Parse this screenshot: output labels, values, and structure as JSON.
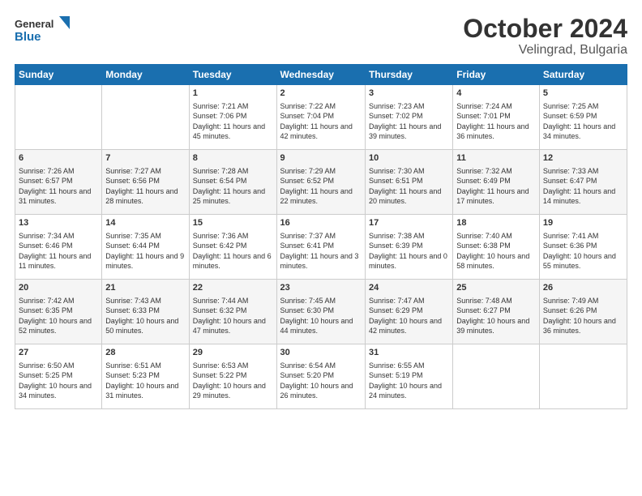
{
  "header": {
    "logo_line1": "General",
    "logo_line2": "Blue",
    "month": "October 2024",
    "location": "Velingrad, Bulgaria"
  },
  "days_of_week": [
    "Sunday",
    "Monday",
    "Tuesday",
    "Wednesday",
    "Thursday",
    "Friday",
    "Saturday"
  ],
  "weeks": [
    [
      {
        "num": "",
        "info": ""
      },
      {
        "num": "",
        "info": ""
      },
      {
        "num": "1",
        "info": "Sunrise: 7:21 AM\nSunset: 7:06 PM\nDaylight: 11 hours and 45 minutes."
      },
      {
        "num": "2",
        "info": "Sunrise: 7:22 AM\nSunset: 7:04 PM\nDaylight: 11 hours and 42 minutes."
      },
      {
        "num": "3",
        "info": "Sunrise: 7:23 AM\nSunset: 7:02 PM\nDaylight: 11 hours and 39 minutes."
      },
      {
        "num": "4",
        "info": "Sunrise: 7:24 AM\nSunset: 7:01 PM\nDaylight: 11 hours and 36 minutes."
      },
      {
        "num": "5",
        "info": "Sunrise: 7:25 AM\nSunset: 6:59 PM\nDaylight: 11 hours and 34 minutes."
      }
    ],
    [
      {
        "num": "6",
        "info": "Sunrise: 7:26 AM\nSunset: 6:57 PM\nDaylight: 11 hours and 31 minutes."
      },
      {
        "num": "7",
        "info": "Sunrise: 7:27 AM\nSunset: 6:56 PM\nDaylight: 11 hours and 28 minutes."
      },
      {
        "num": "8",
        "info": "Sunrise: 7:28 AM\nSunset: 6:54 PM\nDaylight: 11 hours and 25 minutes."
      },
      {
        "num": "9",
        "info": "Sunrise: 7:29 AM\nSunset: 6:52 PM\nDaylight: 11 hours and 22 minutes."
      },
      {
        "num": "10",
        "info": "Sunrise: 7:30 AM\nSunset: 6:51 PM\nDaylight: 11 hours and 20 minutes."
      },
      {
        "num": "11",
        "info": "Sunrise: 7:32 AM\nSunset: 6:49 PM\nDaylight: 11 hours and 17 minutes."
      },
      {
        "num": "12",
        "info": "Sunrise: 7:33 AM\nSunset: 6:47 PM\nDaylight: 11 hours and 14 minutes."
      }
    ],
    [
      {
        "num": "13",
        "info": "Sunrise: 7:34 AM\nSunset: 6:46 PM\nDaylight: 11 hours and 11 minutes."
      },
      {
        "num": "14",
        "info": "Sunrise: 7:35 AM\nSunset: 6:44 PM\nDaylight: 11 hours and 9 minutes."
      },
      {
        "num": "15",
        "info": "Sunrise: 7:36 AM\nSunset: 6:42 PM\nDaylight: 11 hours and 6 minutes."
      },
      {
        "num": "16",
        "info": "Sunrise: 7:37 AM\nSunset: 6:41 PM\nDaylight: 11 hours and 3 minutes."
      },
      {
        "num": "17",
        "info": "Sunrise: 7:38 AM\nSunset: 6:39 PM\nDaylight: 11 hours and 0 minutes."
      },
      {
        "num": "18",
        "info": "Sunrise: 7:40 AM\nSunset: 6:38 PM\nDaylight: 10 hours and 58 minutes."
      },
      {
        "num": "19",
        "info": "Sunrise: 7:41 AM\nSunset: 6:36 PM\nDaylight: 10 hours and 55 minutes."
      }
    ],
    [
      {
        "num": "20",
        "info": "Sunrise: 7:42 AM\nSunset: 6:35 PM\nDaylight: 10 hours and 52 minutes."
      },
      {
        "num": "21",
        "info": "Sunrise: 7:43 AM\nSunset: 6:33 PM\nDaylight: 10 hours and 50 minutes."
      },
      {
        "num": "22",
        "info": "Sunrise: 7:44 AM\nSunset: 6:32 PM\nDaylight: 10 hours and 47 minutes."
      },
      {
        "num": "23",
        "info": "Sunrise: 7:45 AM\nSunset: 6:30 PM\nDaylight: 10 hours and 44 minutes."
      },
      {
        "num": "24",
        "info": "Sunrise: 7:47 AM\nSunset: 6:29 PM\nDaylight: 10 hours and 42 minutes."
      },
      {
        "num": "25",
        "info": "Sunrise: 7:48 AM\nSunset: 6:27 PM\nDaylight: 10 hours and 39 minutes."
      },
      {
        "num": "26",
        "info": "Sunrise: 7:49 AM\nSunset: 6:26 PM\nDaylight: 10 hours and 36 minutes."
      }
    ],
    [
      {
        "num": "27",
        "info": "Sunrise: 6:50 AM\nSunset: 5:25 PM\nDaylight: 10 hours and 34 minutes."
      },
      {
        "num": "28",
        "info": "Sunrise: 6:51 AM\nSunset: 5:23 PM\nDaylight: 10 hours and 31 minutes."
      },
      {
        "num": "29",
        "info": "Sunrise: 6:53 AM\nSunset: 5:22 PM\nDaylight: 10 hours and 29 minutes."
      },
      {
        "num": "30",
        "info": "Sunrise: 6:54 AM\nSunset: 5:20 PM\nDaylight: 10 hours and 26 minutes."
      },
      {
        "num": "31",
        "info": "Sunrise: 6:55 AM\nSunset: 5:19 PM\nDaylight: 10 hours and 24 minutes."
      },
      {
        "num": "",
        "info": ""
      },
      {
        "num": "",
        "info": ""
      }
    ]
  ]
}
